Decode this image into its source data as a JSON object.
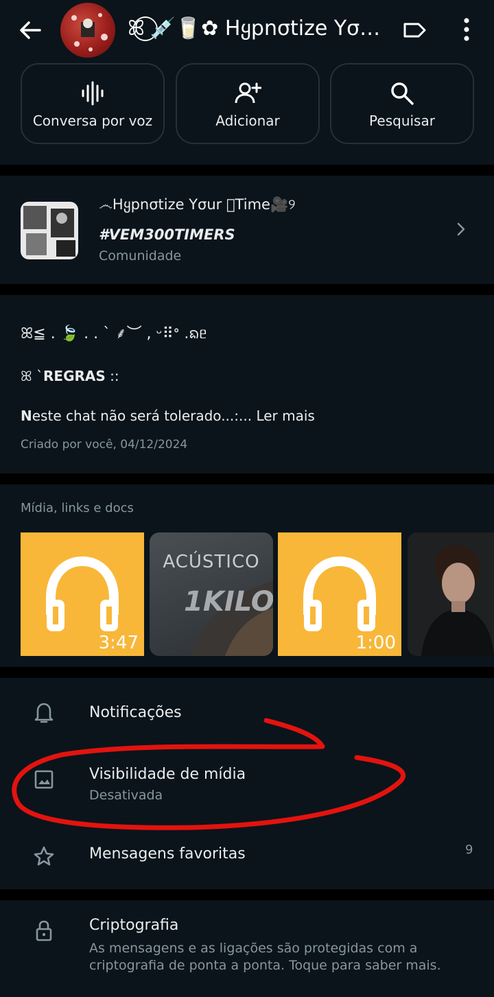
{
  "header": {
    "title": "ꕤ ⃝💉🥛✿ Hყpnσtizе Yσ…",
    "back_icon": "arrow-back-icon",
    "label_icon": "label-tag-icon",
    "more_icon": "more-vert-icon"
  },
  "actions": [
    {
      "label": "Conversa por voz",
      "icon": "voice-waveform-icon"
    },
    {
      "label": "Adicionar",
      "icon": "add-person-icon"
    },
    {
      "label": "Pesquisar",
      "icon": "search-icon"
    }
  ],
  "community": {
    "name_line1": "෴Hყpnσtizе Yσur ⃞Timе🎥୨",
    "name_line2": "#VEM300TIMERS",
    "subtitle": "Comunidade"
  },
  "description": {
    "line1": "ꕤ≦ . 🍃 . . ` ⸙︶ , ᵕ⠿ᐤ .ᨦᥱ",
    "line2_prefix": "ꕤ `",
    "line2_bold": "REGRAS",
    "line2_suffix": " ::",
    "line3_initial": "N",
    "line3_text": "este chat não será tolerado...:... ",
    "read_more": "Ler mais",
    "created": "Criado por você, 04/12/2024"
  },
  "media": {
    "label": "Mídia, links e docs",
    "items": [
      {
        "type": "audio",
        "duration": "3:47"
      },
      {
        "type": "album",
        "title": "ACÚSTICO",
        "logo": "1KILO"
      },
      {
        "type": "audio",
        "duration": "1:00"
      },
      {
        "type": "photo"
      }
    ]
  },
  "settings": {
    "notifications": {
      "title": "Notificações",
      "icon": "bell-icon"
    },
    "media_visibility": {
      "title": "Visibilidade de mídia",
      "subtitle": "Desativada",
      "icon": "image-icon"
    },
    "starred": {
      "title": "Mensagens favoritas",
      "count": "9",
      "icon": "star-icon"
    }
  },
  "encryption": {
    "title": "Criptografia",
    "description": "As mensagens e as ligações são protegidas com a criptografia de ponta a ponta. Toque para saber mais.",
    "icon": "lock-icon"
  },
  "colors": {
    "background": "#0b141a",
    "separator": "#000000",
    "audio_thumb": "#f8b739",
    "annotation": "#e3130f",
    "secondary_text": "#8696a0"
  }
}
